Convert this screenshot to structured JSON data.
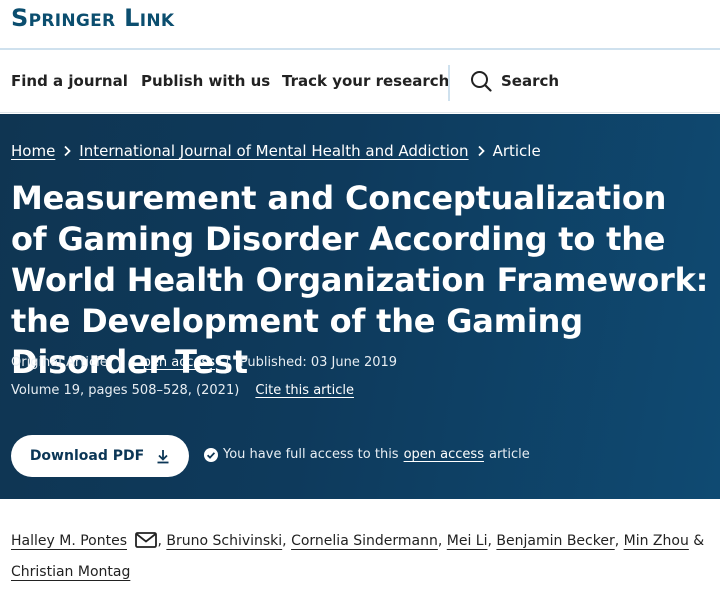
{
  "header": {
    "logo": "Springer Link"
  },
  "nav": {
    "find_journal": "Find a journal",
    "publish": "Publish with us",
    "track": "Track your research",
    "search": "Search"
  },
  "breadcrumb": {
    "home": "Home",
    "journal": "International Journal of Mental Health and Addiction",
    "current": "Article"
  },
  "article": {
    "title": "Measurement and Conceptualization of Gaming Disorder According to the World Health Organization Framework: the Development of the Gaming Disorder Test",
    "type": "Original Article",
    "open_access": "Open access",
    "published": "Published: 03 June 2019",
    "volume": "Volume 19, pages 508–528, (2021)",
    "cite": "Cite this article"
  },
  "actions": {
    "download": "Download PDF",
    "access_prefix": "You have full access to this",
    "access_link": "open access",
    "access_suffix": "article"
  },
  "authors": [
    "Halley M. Pontes",
    "Bruno Schivinski",
    "Cornelia Sindermann",
    "Mei Li",
    "Benjamin Becker",
    "Min Zhou",
    "Christian Montag"
  ],
  "separators": {
    "comma": ",",
    "amp": "&",
    "pipe": "|"
  },
  "icons": [
    "search-icon",
    "chevron-right-icon",
    "download-icon",
    "check-circle-icon",
    "mail-icon"
  ]
}
